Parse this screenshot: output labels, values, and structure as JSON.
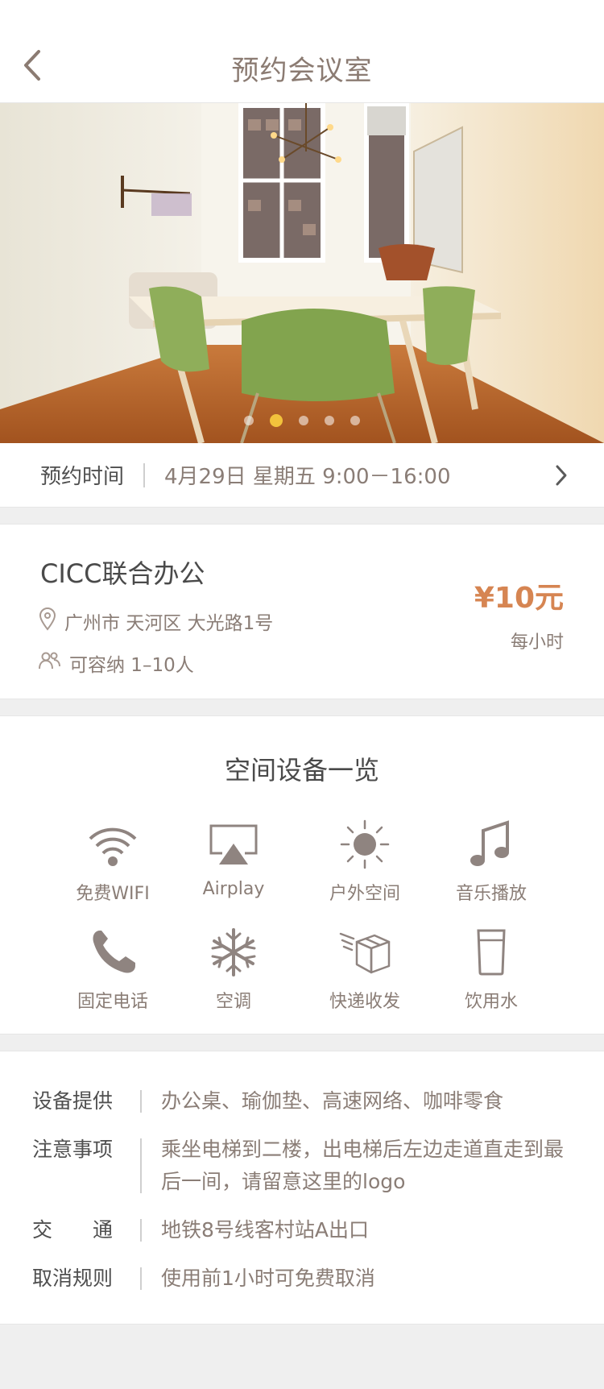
{
  "header": {
    "title": "预约会议室",
    "back_icon": "chevron-left-icon"
  },
  "hero": {
    "slides": 5,
    "active_slide": 2,
    "image_alt": "会议室"
  },
  "booking": {
    "label": "预约时间",
    "value": "4月29日  星期五  9:00－16:00"
  },
  "space": {
    "name": "CICC联合办公",
    "address": "广州市 天河区 大光路1号",
    "capacity": "可容纳 1–10人",
    "price": "¥10元",
    "price_unit": "每小时"
  },
  "equipment": {
    "title": "空间设备一览",
    "items": [
      {
        "label": "免费WIFI",
        "icon": "wifi-icon"
      },
      {
        "label": "Airplay",
        "icon": "airplay-icon"
      },
      {
        "label": "户外空间",
        "icon": "sun-icon"
      },
      {
        "label": "音乐播放",
        "icon": "music-icon"
      },
      {
        "label": "固定电话",
        "icon": "phone-icon"
      },
      {
        "label": "空调",
        "icon": "snowflake-icon"
      },
      {
        "label": "快递收发",
        "icon": "package-icon"
      },
      {
        "label": "饮用水",
        "icon": "water-cup-icon"
      }
    ]
  },
  "details": [
    {
      "label": "设备提供",
      "value": "办公桌、瑜伽垫、高速网络、咖啡零食"
    },
    {
      "label": "注意事项",
      "value": "乘坐电梯到二楼，出电梯后左边走道直走到最后一间，请留意这里的logo"
    },
    {
      "label": "交　　通",
      "value": "地铁8号线客村站A出口"
    },
    {
      "label": "取消规则",
      "value": "使用前1小时可免费取消"
    }
  ],
  "colors": {
    "accent": "#d68552",
    "muted_text": "#8a7d76",
    "dot_active": "#f2c23c"
  }
}
